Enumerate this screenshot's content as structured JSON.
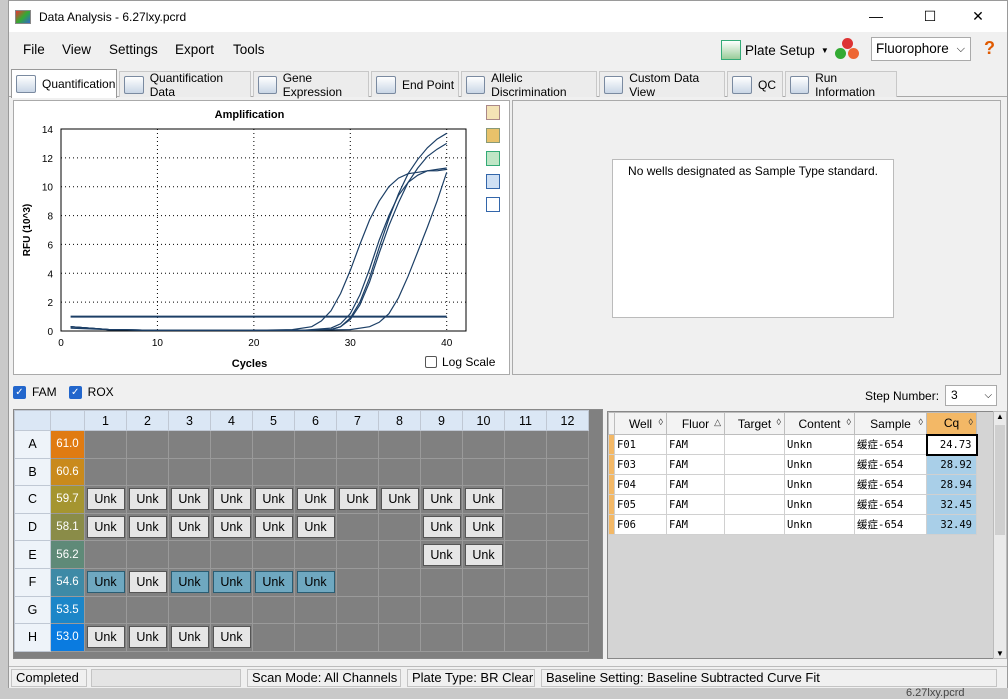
{
  "window": {
    "title": "Data Analysis - 6.27lxy.pcrd"
  },
  "menu": [
    "File",
    "View",
    "Settings",
    "Export",
    "Tools"
  ],
  "toolbar": {
    "plate_setup": "Plate Setup",
    "fluorophore": "Fluorophore"
  },
  "tabs": [
    "Quantification",
    "Quantification Data",
    "Gene Expression",
    "End Point",
    "Allelic Discrimination",
    "Custom Data View",
    "QC",
    "Run Information"
  ],
  "chart_data": {
    "type": "line",
    "title": "Amplification",
    "xlabel": "Cycles",
    "ylabel": "RFU (10^3)",
    "xlim": [
      0,
      42
    ],
    "ylim": [
      0,
      14
    ],
    "xticks": [
      0,
      10,
      20,
      30,
      40
    ],
    "yticks": [
      0,
      2,
      4,
      6,
      8,
      10,
      12,
      14
    ],
    "grid": true,
    "series_color": "#1c3f66",
    "series": [
      {
        "x": [
          1,
          5,
          10,
          15,
          20,
          24,
          26,
          27,
          28,
          29,
          30,
          31,
          32,
          33,
          34,
          35,
          36,
          37,
          38,
          39,
          40
        ],
        "values": [
          0.3,
          0.1,
          0.05,
          0.05,
          0.05,
          0.1,
          0.3,
          0.7,
          1.4,
          2.6,
          4.2,
          6.0,
          7.7,
          9.0,
          10.0,
          10.6,
          10.9,
          11.0,
          11.1,
          11.1,
          11.2
        ]
      },
      {
        "x": [
          1,
          5,
          10,
          15,
          20,
          25,
          28,
          29,
          30,
          31,
          32,
          33,
          34,
          35,
          36,
          37,
          38,
          39,
          40
        ],
        "values": [
          0.3,
          0.1,
          0.05,
          0.05,
          0.05,
          0.05,
          0.2,
          0.5,
          1.2,
          2.5,
          4.3,
          6.3,
          8.0,
          9.4,
          10.3,
          10.8,
          11.1,
          11.2,
          11.3
        ]
      },
      {
        "x": [
          1,
          5,
          10,
          15,
          20,
          25,
          28,
          29,
          30,
          31,
          32,
          33,
          34,
          35,
          36,
          37,
          38,
          39,
          40
        ],
        "values": [
          0.3,
          0.1,
          0.05,
          0.05,
          0.05,
          0.05,
          0.1,
          0.3,
          0.8,
          1.8,
          3.4,
          5.4,
          7.3,
          8.9,
          10.3,
          11.3,
          12.1,
          12.6,
          13.0
        ]
      },
      {
        "x": [
          1,
          5,
          10,
          15,
          20,
          25,
          28,
          29,
          30,
          31,
          32,
          33,
          34,
          35,
          36,
          37,
          38,
          39,
          40
        ],
        "values": [
          0.3,
          0.1,
          0.05,
          0.05,
          0.05,
          0.05,
          0.1,
          0.3,
          0.9,
          2.0,
          3.7,
          5.8,
          7.8,
          9.5,
          10.9,
          11.9,
          12.7,
          13.3,
          13.7
        ]
      },
      {
        "x": [
          1,
          5,
          10,
          15,
          20,
          25,
          30,
          32,
          33,
          34,
          35,
          36,
          37,
          38,
          39,
          40
        ],
        "values": [
          0.2,
          0.1,
          0.05,
          0.05,
          0.05,
          0.05,
          0.1,
          0.3,
          0.6,
          1.2,
          2.3,
          3.8,
          5.5,
          7.2,
          9.0,
          11.0
        ]
      },
      {
        "x": [
          1,
          40
        ],
        "values": [
          1.0,
          1.0
        ]
      }
    ]
  },
  "chart": {
    "log_scale_label": "Log Scale"
  },
  "standard_msg": "No wells designated as Sample Type standard.",
  "fluors": {
    "fam": "FAM",
    "rox": "ROX"
  },
  "step": {
    "label": "Step Number:",
    "value": "3"
  },
  "plate": {
    "columns": [
      "1",
      "2",
      "3",
      "4",
      "5",
      "6",
      "7",
      "8",
      "9",
      "10",
      "11",
      "12"
    ],
    "rows": [
      {
        "label": "A",
        "grad": "61.0",
        "color": "#e07b12",
        "wells": [
          "",
          "",
          "",
          "",
          "",
          "",
          "",
          "",
          "",
          "",
          "",
          ""
        ]
      },
      {
        "label": "B",
        "grad": "60.6",
        "color": "#c98a1c",
        "wells": [
          "",
          "",
          "",
          "",
          "",
          "",
          "",
          "",
          "",
          "",
          "",
          ""
        ]
      },
      {
        "label": "C",
        "grad": "59.7",
        "color": "#a59530",
        "wells": [
          "Unk",
          "Unk",
          "Unk",
          "Unk",
          "Unk",
          "Unk",
          "Unk",
          "Unk",
          "Unk",
          "Unk",
          "",
          ""
        ]
      },
      {
        "label": "D",
        "grad": "58.1",
        "color": "#8a8c48",
        "wells": [
          "Unk",
          "Unk",
          "Unk",
          "Unk",
          "Unk",
          "Unk",
          "",
          "",
          "Unk",
          "Unk",
          "",
          ""
        ]
      },
      {
        "label": "E",
        "grad": "56.2",
        "color": "#5f8a78",
        "wells": [
          "",
          "",
          "",
          "",
          "",
          "",
          "",
          "",
          "Unk",
          "Unk",
          "",
          ""
        ]
      },
      {
        "label": "F",
        "grad": "54.6",
        "color": "#3e8aa6",
        "wells": [
          "Unk",
          "Unk",
          "Unk",
          "Unk",
          "Unk",
          "Unk",
          "",
          "",
          "",
          "",
          "",
          ""
        ]
      },
      {
        "label": "G",
        "grad": "53.5",
        "color": "#1c86c8",
        "wells": [
          "",
          "",
          "",
          "",
          "",
          "",
          "",
          "",
          "",
          "",
          "",
          ""
        ]
      },
      {
        "label": "H",
        "grad": "53.0",
        "color": "#0a7be0",
        "wells": [
          "Unk",
          "Unk",
          "Unk",
          "Unk",
          "",
          "",
          "",
          "",
          "",
          "",
          "",
          ""
        ]
      }
    ],
    "selected": [
      "F1",
      "F3",
      "F4",
      "F5",
      "F6"
    ]
  },
  "table": {
    "headers": [
      "Well",
      "Fluor",
      "Target",
      "Content",
      "Sample",
      "Cq"
    ],
    "rows": [
      [
        "F01",
        "FAM",
        "",
        "Unkn",
        "缓症-654",
        "24.73"
      ],
      [
        "F03",
        "FAM",
        "",
        "Unkn",
        "缓症-654",
        "28.92"
      ],
      [
        "F04",
        "FAM",
        "",
        "Unkn",
        "缓症-654",
        "28.94"
      ],
      [
        "F05",
        "FAM",
        "",
        "Unkn",
        "缓症-654",
        "32.45"
      ],
      [
        "F06",
        "FAM",
        "",
        "Unkn",
        "缓症-654",
        "32.49"
      ]
    ]
  },
  "status": {
    "state": "Completed",
    "scan": "Scan Mode: All Channels",
    "plate": "Plate Type: BR Clear",
    "baseline": "Baseline Setting: Baseline Subtracted Curve Fit"
  },
  "taskbar_hint": "6.27lxy.pcrd"
}
